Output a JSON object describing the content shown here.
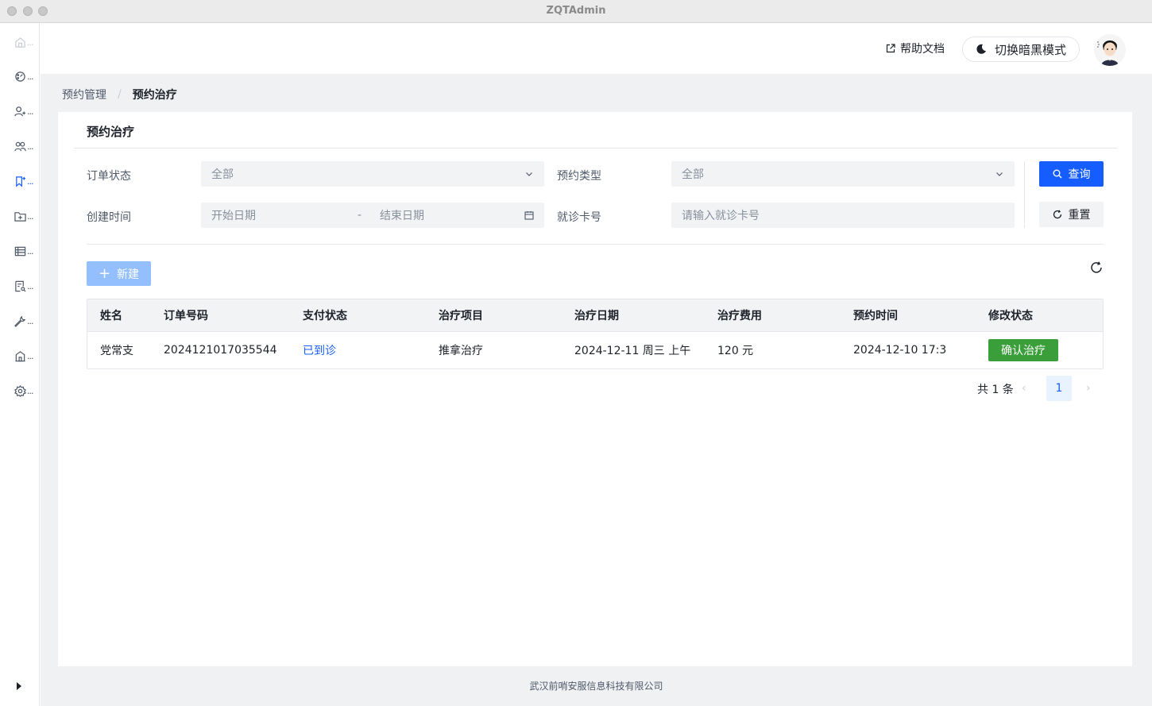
{
  "window": {
    "title": "ZQTAdmin"
  },
  "sidebar": {
    "items": [
      {
        "icon": "home-icon",
        "dots": "..."
      },
      {
        "icon": "dashboard-icon",
        "dots": "..."
      },
      {
        "icon": "user-add-icon",
        "dots": "..."
      },
      {
        "icon": "users-icon",
        "dots": "..."
      },
      {
        "icon": "bookmark-icon",
        "dots": "..."
      },
      {
        "icon": "folder-add-icon",
        "dots": "..."
      },
      {
        "icon": "table-icon",
        "dots": "..."
      },
      {
        "icon": "file-search-icon",
        "dots": "..."
      },
      {
        "icon": "tool-icon",
        "dots": "..."
      },
      {
        "icon": "building-icon",
        "dots": "..."
      },
      {
        "icon": "settings-icon",
        "dots": "..."
      }
    ]
  },
  "header": {
    "help_label": "帮助文档",
    "theme_label": "切换暗黑模式"
  },
  "breadcrumb": {
    "parent": "预约管理",
    "sep": "/",
    "current": "预约治疗"
  },
  "card": {
    "title": "预约治疗"
  },
  "filters": {
    "order_status": {
      "label": "订单状态",
      "value": "全部"
    },
    "appointment_type": {
      "label": "预约类型",
      "value": "全部"
    },
    "created_time": {
      "label": "创建时间",
      "start_placeholder": "开始日期",
      "sep": "-",
      "end_placeholder": "结束日期"
    },
    "card_number": {
      "label": "就诊卡号",
      "placeholder": "请输入就诊卡号"
    }
  },
  "buttons": {
    "query": "查询",
    "reset": "重置",
    "new": "新建",
    "new_plus": "+"
  },
  "table": {
    "columns": [
      "姓名",
      "订单号码",
      "支付状态",
      "治疗项目",
      "治疗日期",
      "治疗费用",
      "预约时间",
      "修改状态"
    ],
    "rows": [
      {
        "name": "党常支",
        "order_no": "2024121017035544",
        "pay_status": "已到诊",
        "item": "推拿治疗",
        "date": "2024-12-11 周三 上午",
        "fee": "120 元",
        "booked_at": "2024-12-10 17:3",
        "action": "确认治疗"
      }
    ]
  },
  "pagination": {
    "total": "共 1 条",
    "prev": "‹",
    "current": "1",
    "next": "›"
  },
  "footer": {
    "text": "武汉前哨安服信息科技有限公司"
  },
  "colors": {
    "primary": "#165dff",
    "success": "#3a9e3a",
    "new_disabled": "#94bfff"
  }
}
